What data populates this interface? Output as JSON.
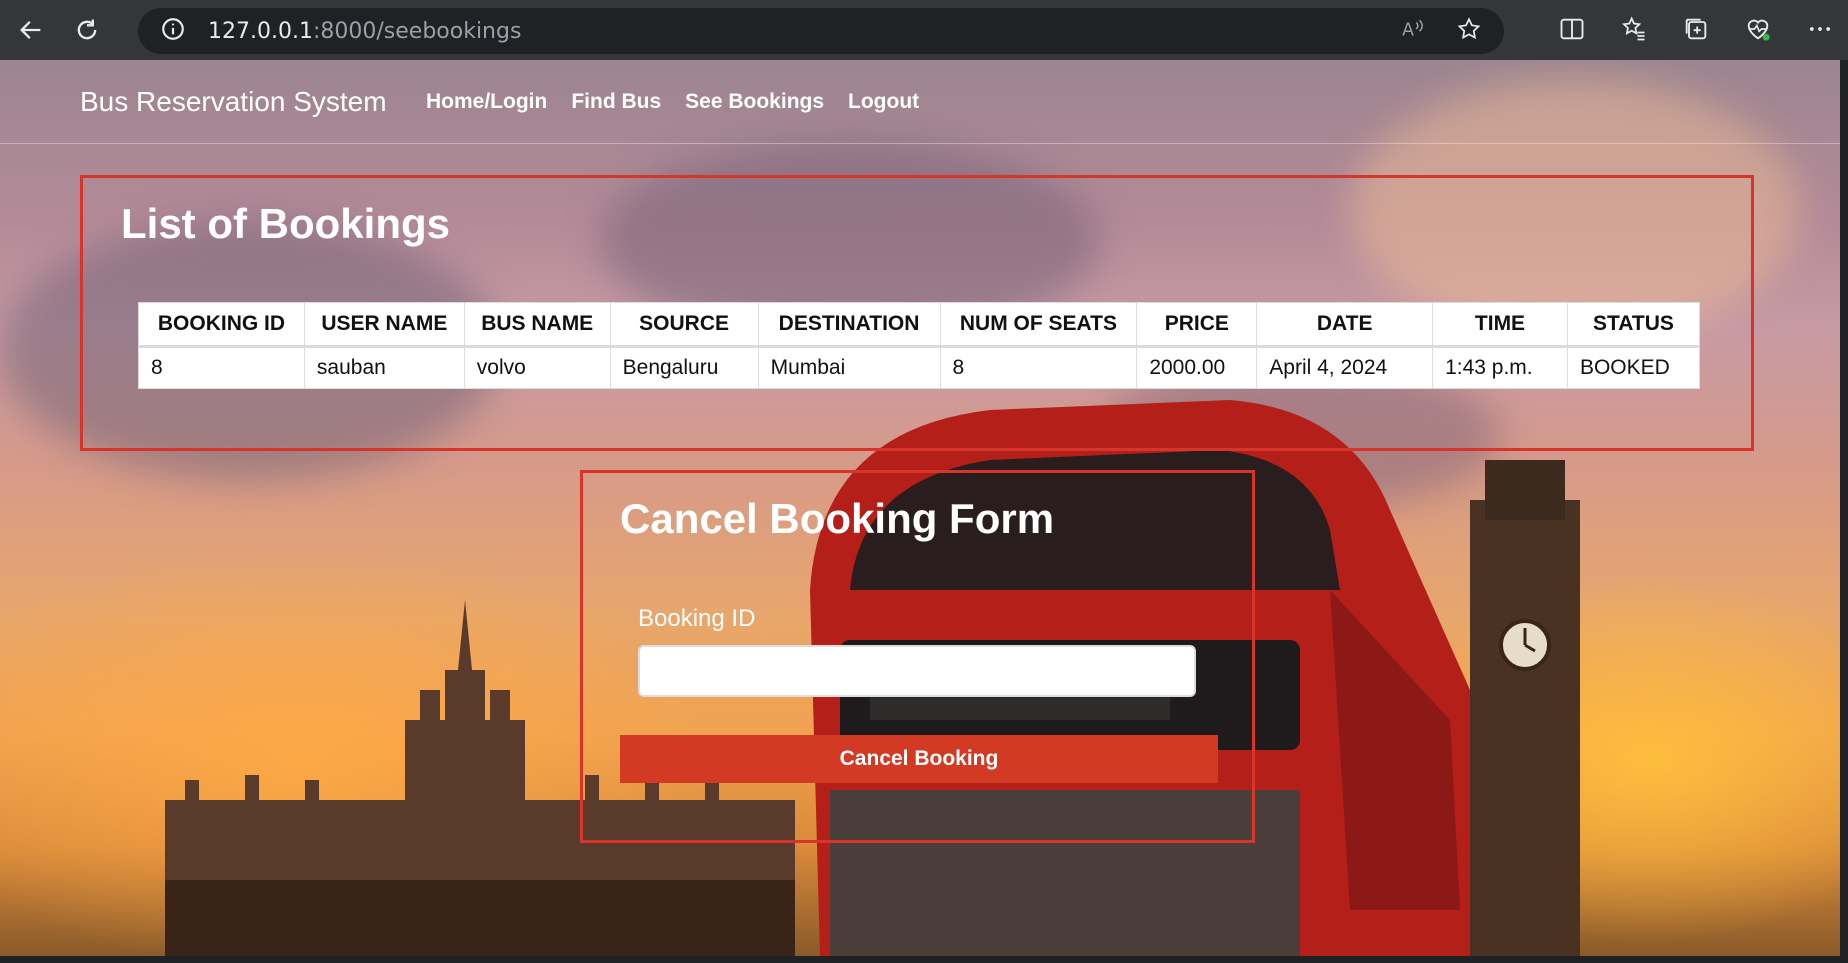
{
  "browser": {
    "url_host": "127.0.0.1",
    "url_path": ":8000/seebookings"
  },
  "navbar": {
    "brand": "Bus Reservation System",
    "links": [
      "Home/Login",
      "Find Bus",
      "See Bookings",
      "Logout"
    ]
  },
  "bookings": {
    "title": "List of Bookings",
    "columns": [
      "BOOKING ID",
      "USER NAME",
      "BUS NAME",
      "SOURCE",
      "DESTINATION",
      "NUM OF SEATS",
      "PRICE",
      "DATE",
      "TIME",
      "STATUS"
    ],
    "rows": [
      [
        "8",
        "sauban",
        "volvo",
        "Bengaluru",
        "Mumbai",
        "8",
        "2000.00",
        "April 4, 2024",
        "1:43 p.m.",
        "BOOKED"
      ]
    ]
  },
  "cancel_form": {
    "title": "Cancel Booking Form",
    "field_label": "Booking ID",
    "field_value": "",
    "button_label": "Cancel Booking"
  },
  "colors": {
    "accent_red": "#d8352a",
    "button_red": "#d23a24"
  }
}
